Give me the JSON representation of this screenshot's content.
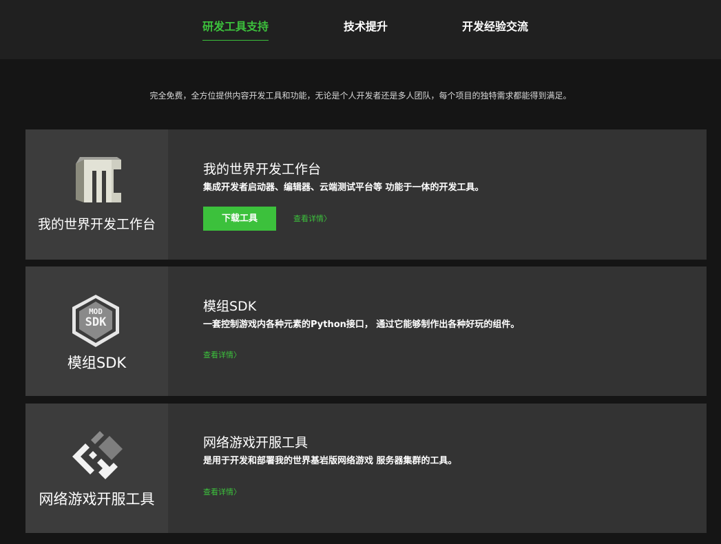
{
  "nav": {
    "tabs": [
      {
        "label": "研发工具支持",
        "active": true
      },
      {
        "label": "技术提升",
        "active": false
      },
      {
        "label": "开发经验交流",
        "active": false
      }
    ]
  },
  "tagline": "完全免费，全方位提供内容开发工具和功能，无论是个人开发者还是多人团队，每个项目的独特需求都能得到满足。",
  "cards": [
    {
      "logo_icon": "mc-logo-icon",
      "logo_caption": "我的世界开发工作台",
      "title": "我的世界开发工作台",
      "description": "集成开发者启动器、编辑器、云端测试平台等 功能于一体的开发工具。",
      "download_label": "下载工具",
      "details_label": "查看详情〉"
    },
    {
      "logo_icon": "mod-sdk-logo-icon",
      "logo_text_top": "MOD",
      "logo_text_bottom": "SDK",
      "logo_caption": "模组SDK",
      "title": "模组SDK",
      "description": "一套控制游戏内各种元素的Python接口， 通过它能够制作出各种好玩的组件。",
      "details_label": "查看详情〉"
    },
    {
      "logo_icon": "server-tool-logo-icon",
      "logo_caption": "网络游戏开服工具",
      "title": "网络游戏开服工具",
      "description": "是用于开发和部署我的世界基岩版网络游戏 服务器集群的工具。",
      "details_label": "查看详情〉"
    }
  ],
  "colors": {
    "accent": "#3cc13c",
    "page_bg": "#151515",
    "nav_bg": "#202020",
    "card_bg": "#333333",
    "logo_bg": "#3c3c3c"
  }
}
